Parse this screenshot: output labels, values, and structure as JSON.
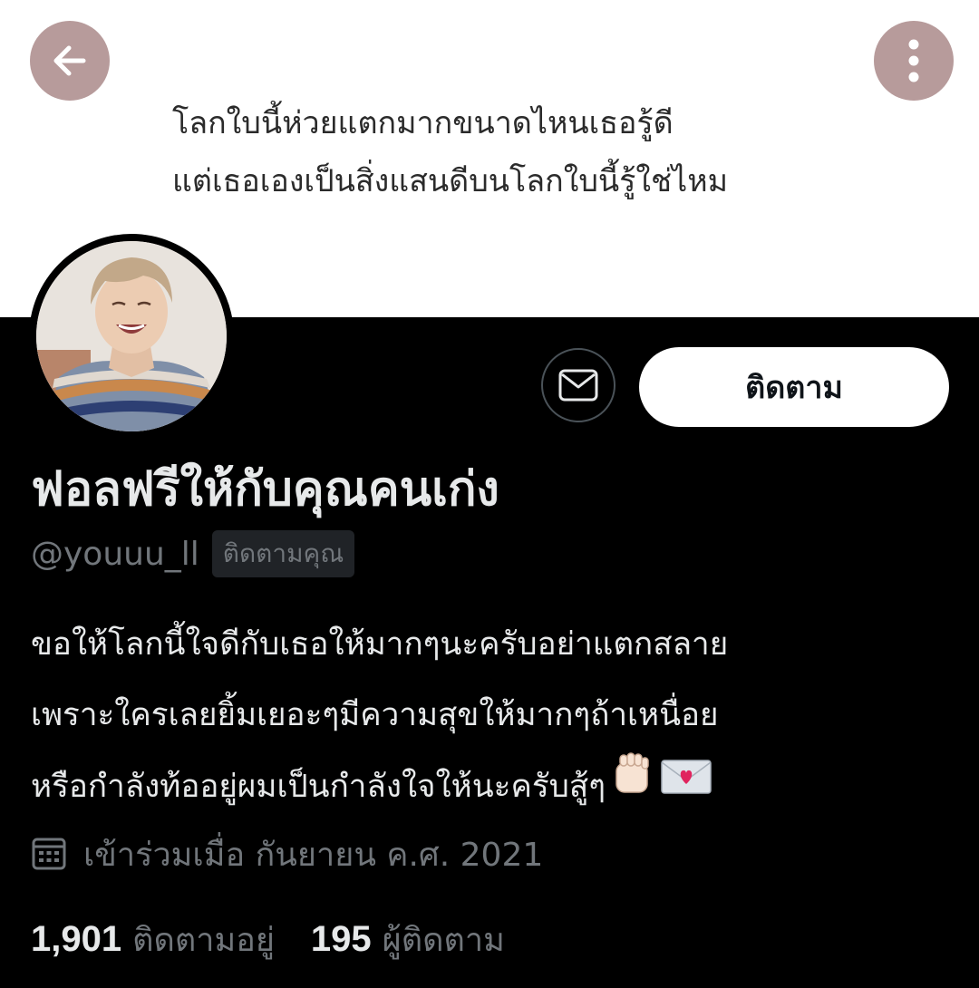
{
  "banner": {
    "line1": "โลกใบนี้ห่วยแตกมากขนาดไหนเธอรู้ดี",
    "line2": "แต่เธอเองเป็นสิ่งแสนดีบนโลกใบนี้รู้ใช่ไหม"
  },
  "nav": {
    "back_icon": "arrow-left-icon",
    "more_icon": "more-vertical-icon"
  },
  "profile": {
    "display_name": "ฟอลฟรีให้กับคุณคนเก่ง",
    "handle": "@youuu_ll",
    "follows_you_label": "ติดตามคุณ",
    "bio_lines": [
      "ขอให้โลกนี้ใจดีกับเธอให้มากๆนะครับอย่าแตกสลาย",
      "เพราะใครเลยยิ้มเยอะๆมีความสุขให้มากๆถ้าเหนื่อย",
      "หรือกำลังท้ออยู่ผมเป็นกำลังใจให้นะครับสู้ๆ"
    ],
    "bio_emojis": [
      "raised-fist-icon",
      "love-letter-icon"
    ],
    "joined": "เข้าร่วมเมื่อ กันยายน ค.ศ. 2021",
    "following_count": "1,901",
    "following_label": "ติดตามอยู่",
    "followers_count": "195",
    "followers_label": "ผู้ติดตาม"
  },
  "actions": {
    "message_icon": "envelope-icon",
    "follow_label": "ติดตาม"
  },
  "colors": {
    "background": "#000000",
    "banner": "#ffffff",
    "nav_button": "#b79b9b",
    "primary_text": "#e7e9ea",
    "secondary_text": "#71767b",
    "follow_button_bg": "#ffffff"
  }
}
